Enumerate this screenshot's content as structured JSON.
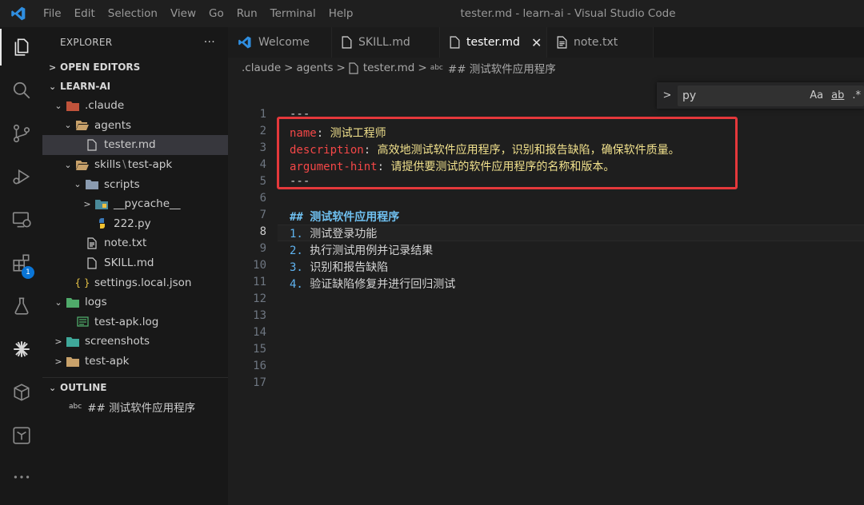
{
  "titlebar": {
    "menu": [
      "File",
      "Edit",
      "Selection",
      "View",
      "Go",
      "Run",
      "Terminal",
      "Help"
    ],
    "window_title": "tester.md - learn-ai - Visual Studio Code"
  },
  "activity_bar": {
    "items": [
      "explorer-icon",
      "search-icon",
      "source-control-icon",
      "run-debug-icon",
      "remote-explorer-icon",
      "extensions-icon",
      "testing-icon",
      "claude-icon",
      "containers-icon",
      "terraform-icon",
      "more-icon"
    ],
    "extensions_badge": "1"
  },
  "explorer": {
    "title": "EXPLORER",
    "more": "···",
    "open_editors": "OPEN EDITORS",
    "root": "LEARN-AI",
    "tree": [
      {
        "label": ".claude",
        "indent": 1,
        "twisty": "⌄"
      },
      {
        "label": "agents",
        "indent": 2,
        "twisty": "⌄"
      },
      {
        "label": "tester.md",
        "indent": 3,
        "twisty": ""
      },
      {
        "label": "skills",
        "label2": "test-apk",
        "indent": 2,
        "twisty": "⌄"
      },
      {
        "label": "scripts",
        "indent": 3,
        "twisty": "⌄"
      },
      {
        "label": "__pycache__",
        "indent": 4,
        "twisty": ">"
      },
      {
        "label": "222.py",
        "indent": 4,
        "twisty": ""
      },
      {
        "label": "note.txt",
        "indent": 3,
        "twisty": ""
      },
      {
        "label": "SKILL.md",
        "indent": 3,
        "twisty": ""
      },
      {
        "label": "settings.local.json",
        "indent": 2,
        "twisty": ""
      },
      {
        "label": "logs",
        "indent": 1,
        "twisty": "⌄"
      },
      {
        "label": "test-apk.log",
        "indent": 2,
        "twisty": ""
      },
      {
        "label": "screenshots",
        "indent": 1,
        "twisty": ">"
      },
      {
        "label": "test-apk",
        "indent": 1,
        "twisty": ">"
      }
    ],
    "outline_title": "OUTLINE",
    "outline_item": "## 测试软件应用程序",
    "abc": "abc"
  },
  "tabs": [
    {
      "label": "Welcome"
    },
    {
      "label": "SKILL.md"
    },
    {
      "label": "tester.md",
      "close": "✕"
    },
    {
      "label": "note.txt"
    }
  ],
  "breadcrumb": [
    ".claude",
    "agents",
    "tester.md",
    "## 测试软件应用程序"
  ],
  "find": {
    "value": "py",
    "opt_case": "Aa",
    "opt_word": "ab",
    "opt_regex": ".*"
  },
  "editor": {
    "line_numbers": [
      "1",
      "2",
      "3",
      "4",
      "5",
      "6",
      "7",
      "8",
      "9",
      "10",
      "11",
      "12",
      "13",
      "14",
      "15",
      "16",
      "17"
    ],
    "current_line": "8",
    "lines": {
      "l1": "---",
      "l2_key": "name",
      "l2_val": "测试工程师",
      "l3_key": "description",
      "l3_val": "高效地测试软件应用程序，识别和报告缺陷，确保软件质量。",
      "l4_key": "argument-hint",
      "l4_val": "请提供要测试的软件应用程序的名称和版本。",
      "l5": "---",
      "l7": "## 测试软件应用程序",
      "l8_n": "1.",
      "l8": "测试登录功能",
      "l9_n": "2.",
      "l9": "执行测试用例并记录结果",
      "l10_n": "3.",
      "l10": "识别和报告缺陷",
      "l11_n": "4.",
      "l11": "验证缺陷修复并进行回归测试"
    }
  },
  "colors": {
    "highlight_box": "#e5383b",
    "accent": "#0a75d6"
  }
}
